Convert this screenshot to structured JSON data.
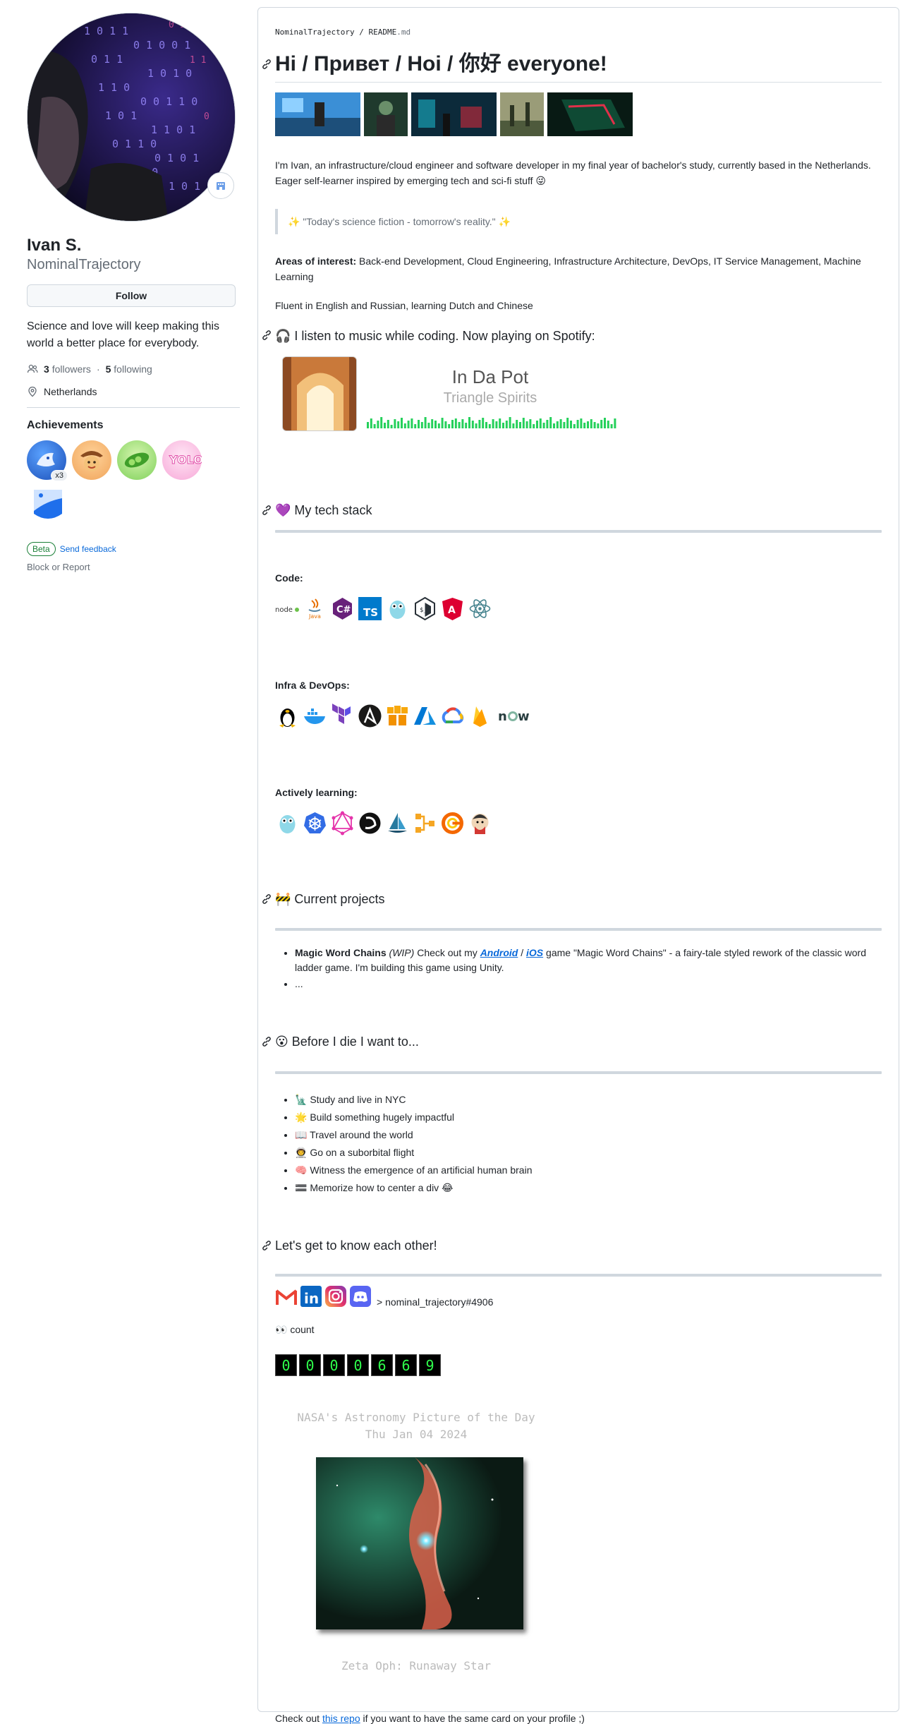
{
  "profile": {
    "name": "Ivan S.",
    "login": "NominalTrajectory",
    "follow_label": "Follow",
    "bio": "Science and love will keep making this world a better place for everybody.",
    "followers_count": "3",
    "followers_label": "followers",
    "separator": "·",
    "following_count": "5",
    "following_label": "following",
    "location": "Netherlands",
    "achievements_title": "Achievements",
    "achievement_multiplier": "x3",
    "beta_label": "Beta",
    "send_feedback": "Send feedback",
    "block_report": "Block or Report"
  },
  "readme": {
    "crumb_owner": "NominalTrajectory",
    "crumb_sep": " / ",
    "crumb_file": "README",
    "crumb_ext": ".md",
    "title": "Hi / Привет / Hoi / 你好 everyone!",
    "intro": "I'm Ivan, an infrastructure/cloud engineer and software developer in my final year of bachelor's study, currently based in the Netherlands. Eager self-learner inspired by emerging tech and sci-fi stuff 😜",
    "quote": "✨ \"Today's science fiction - tomorrow's reality.\" ✨",
    "areas_label": "Areas of interest:",
    "areas_text": " Back-end Development, Cloud Engineering, Infrastructure Architecture, DevOps, IT Service Management, Machine Learning",
    "languages": "Fluent in English and Russian, learning Dutch and Chinese",
    "music_heading": "🎧 I listen to music while coding. Now playing on Spotify:",
    "spotify_track": "In Da Pot",
    "spotify_artist": "Triangle Spirits",
    "stack_heading": "💜 My tech stack",
    "code_label": "Code:",
    "infra_label": "Infra & DevOps:",
    "learning_label": "Actively learning:",
    "projects_heading": "🚧 Current projects",
    "project_name": "Magic Word Chains",
    "project_wip": " (WIP)",
    "project_text1": " Check out my ",
    "project_android": "Android",
    "project_slash": " / ",
    "project_ios": "iOS",
    "project_text2": " game \"Magic Word Chains\" - a fairy-tale styled rework of the classic word ladder game. I'm building this game using Unity.",
    "project_more": "...",
    "bucket_heading": "😮 Before I die I want to...",
    "bucket_items": [
      "🗽 Study and live in NYC",
      "🌟 Build something hugely impactful",
      "📖 Travel around the world",
      "👨‍🚀 Go on a suborbital flight",
      "🧠 Witness the emergence of an artificial human brain",
      "🟰 Memorize how to center a div 😂"
    ],
    "contact_heading": "Let's get to know each other!",
    "discord_text": "> nominal_trajectory#4906",
    "count_label": "👀 count",
    "counter_digits": [
      "0",
      "0",
      "0",
      "0",
      "6",
      "6",
      "9"
    ],
    "apod_title": "NASA's Astronomy Picture of the Day",
    "apod_date": "Thu Jan 04 2024",
    "apod_name": "Zeta Oph: Runaway Star",
    "footer_text1": "Check out ",
    "footer_link": "this repo",
    "footer_text2": " if you want to have the same card on your profile ;)"
  },
  "icons": {
    "code": [
      "nodejs-icon",
      "java-icon",
      "csharp-icon",
      "typescript-icon",
      "go-gopher-icon",
      "bash-icon",
      "angular-icon",
      "electron-icon"
    ],
    "infra": [
      "linux-icon",
      "docker-icon",
      "terraform-icon",
      "ansible-icon",
      "aws-icon",
      "azure-icon",
      "gcp-icon",
      "firebase-icon",
      "now-icon"
    ],
    "learning": [
      "go-gopher-icon",
      "kubernetes-icon",
      "graphql-icon",
      "dart-icon",
      "helm-icon",
      "argo-icon",
      "grafana-icon",
      "jenkins-icon"
    ],
    "contacts": [
      "gmail-icon",
      "linkedin-icon",
      "instagram-icon",
      "discord-icon"
    ]
  },
  "colors": {
    "link": "#0969da",
    "counter_digit": "#2fff4c",
    "beta": "#1a7f37"
  }
}
